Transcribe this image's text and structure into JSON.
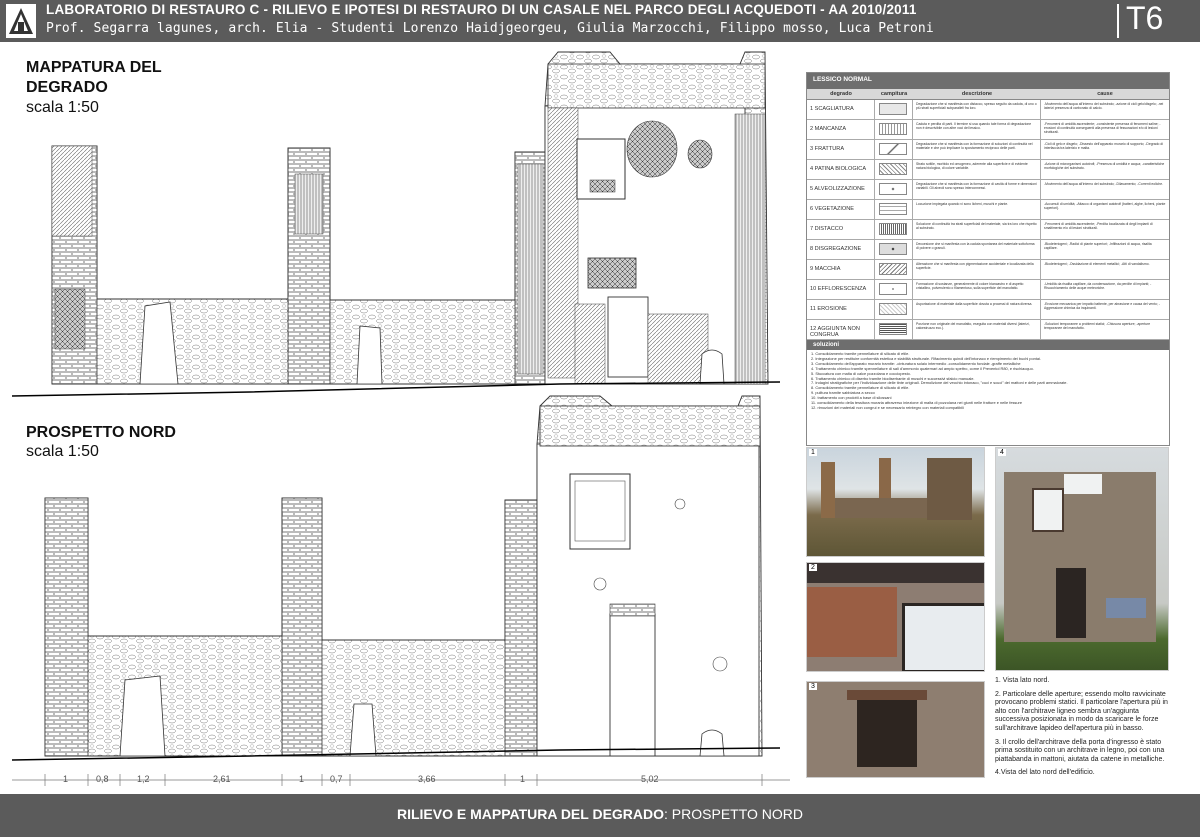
{
  "header": {
    "title": "LABORATORIO DI RESTAURO C - RILIEVO E IPOTESI DI RESTAURO DI UN CASALE NEL PARCO DEGLI ACQUEDOTI - AA 2010/2011",
    "subtitle": "Prof. Segarra lagunes, arch. Elia - Studenti Lorenzo Haidjgeorgeu, Giulia Marzocchi, Filippo mosso, Luca Petroni",
    "code": "T6"
  },
  "section1": {
    "title_line1": "MAPPATURA DEL",
    "title_line2": "DEGRADO",
    "scale": "scala 1:50"
  },
  "section2": {
    "title": "PROSPETTO NORD",
    "scale": "scala 1:50"
  },
  "legend": {
    "title": "LESSICO NORMAL",
    "columns": [
      "degrado",
      "campitura",
      "descrizione",
      "cause"
    ],
    "rows": [
      {
        "label": "1 SCAGLIATURA",
        "desc": "Degradazione che si manifesta con distacco, spesso seguito da caduta, di uno o più strati superficiali subparalleli fra loro.",
        "cause": "-Movimento dell'acqua all'interno del substrato; -azione di cicli gelo/disgelo; -nei laterizi presenza di carbonato di calcio."
      },
      {
        "label": "2 MANCANZA",
        "desc": "Caduta e perdita di parti. Il termine si usa quando tale forma di degradazione non è descrivibile con altre voci del lessico.",
        "cause": "-Fenomeni di umidità ascendente; -consistente presenza di fenomeni saline; -erosioni di continuità conseguenti alla presenza di fessurazioni e/o di lesioni strutturali."
      },
      {
        "label": "3 FRATTURA",
        "desc": "Degradazione che si manifesta con la formazione di soluzioni di continuità nel materiale e che può implicare lo spostamento reciproco delle parti.",
        "cause": "-Cicli di gelo e disgelo; -Dissesto dell'apparato murario di supporto; -Degrado di interfaccia tra laterizio e malta."
      },
      {
        "label": "4 PATINA BIOLOGICA",
        "desc": "Strato sottile, morbido ed omogeneo, aderente alla superficie e di evidente natura biologica, di colore variabile.",
        "cause": "-Azione di microrganismi autotrofi; -Presenza di umidità e acqua; -caratteristiche morfologiche del substrato."
      },
      {
        "label": "5 ALVEOLIZZAZIONE",
        "desc": "Degradazione che si manifesta con la formazione di cavità di forme e dimensioni variabili. Gli alveoli sono spesso interconnessi.",
        "cause": "-Movimento dell'acqua all'interno del substrato; -Dilavamento; -Correnti eoliche."
      },
      {
        "label": "6 VEGETAZIONE",
        "desc": "Locuzione impiegata quando vi sono licheni, muschi e piante.",
        "cause": "-Accumuli di umidità; -Attacco di organismi autotrofi (batteri, alghe, licheni, piante superiori)."
      },
      {
        "label": "7 DISTACCO",
        "desc": "Soluzione di continuità tra strati superficiali del materiale, sia tra loro che rispetto al substrato.",
        "cause": "-Fenomeni di umidità ascendente; -Perdita localizzata di degli impianti di smaltimento e/o di lesioni strutturali."
      },
      {
        "label": "8 DISGREGAZIONE",
        "desc": "Decoesione che si manifesta con la caduta spontanea del materiale sottoforma di polvere o granuli.",
        "cause": "-Biodeteriogeni; -Radici di piante superiori; -Infiltrazioni di acqua, risalita capillare."
      },
      {
        "label": "9 MACCHIA",
        "desc": "Alterazione che si manifesta con pigmentazione accidentale e localizzata della superficie.",
        "cause": "-Biodeteriogeni; -Ossidazione di elementi metallici; -Atti di vandalismo."
      },
      {
        "label": "10 EFFLORESCENZA",
        "desc": "Formazione di sostanze, generalmente di colore biancastro e di aspetto cristallino, pulverulento o filamentoso, sulla superficie del manufatto.",
        "cause": "-Umidità da risalita capillare, da condensazione, da perdite di impianti; -Risucchiamento delle acque meteoriche."
      },
      {
        "label": "11 EROSIONE",
        "desc": "Asportazione di materiale dalla superficie dovuta a processi di natura diversa.",
        "cause": "-Erosione meccanica per impatto battente, per abrasione e causa del vento; -Aggressione chimica da inquinanti."
      },
      {
        "label": "12 AGGIUNTA NON CONGRUA",
        "desc": "Porzione non originale del manufatto, eseguita con materiali diversi (laterizi, calcestruzzo ecc.).",
        "cause": "-Soluzioni temporanee a problemi statici; -Chiusura aperture; -aperture temporanee del manufatto."
      }
    ],
    "solutions_title": "soluzioni",
    "solutions": [
      "1. Consolidamento tramite pennellature di silicato di etile.",
      "2. Integrazione per restituire conformità estetica e stabilità strutturale. Rifacimento quindi dell'intonaco e riempimento dei buchi pontai.",
      "3. Consolidamento dell'apparato murario tramite: -cinturatura solaio intermedio -consolidamento fondale -graffe metalliche",
      "4. Trattamento chimico tramite spennellature di sali d'ammonio quaternari ad ampio spettro, come il Preventol R80, e rischiacquo.",
      "5. Stuccatura con malta di calce pozzolana e cocciopesto.",
      "6. Trattamento chimico di diserbo tramite biodiserbante di muschi e successivi sfalcio manuale.",
      "7. Indagini stratigrafiche per l'individuazione delle tinte originali. Demolizione del vecchio intonaco, \"cuci e scuci\" dei mattoni e delle parti ammalorate.",
      "8. Consolidamento tramite pennellature di silicato di etile.",
      "9. pulitura tramite sabbiatura a secco",
      "10. trattamento con prodotti a base di silossani",
      "11. consolidamento della tessitura muraria attraverso iniezione di malta di pozzolana nei giunti nelle fratture e nelle fessure",
      "12. rimozioni dei materiali non congrui e se necessario reintegro con materiali compatibili"
    ]
  },
  "photos": [
    {
      "num": "1"
    },
    {
      "num": "2"
    },
    {
      "num": "3"
    },
    {
      "num": "4"
    }
  ],
  "captions": [
    "1. Vista lato nord.",
    "2. Particolare delle aperture; essendo molto ravvicinate provocano problemi statici. Il particolare l'apertura più in alto con l'architrave ligneo sembra un'aggiunta successiva posizionata in modo da scaricare le forze sull'architrave lapideo dell'apertura più in basso.",
    "3. Il crollo dell'architrave della porta d'ingresso è stato prima sostituito con un architrave in legno, poi con una piattabanda in mattoni, aiutata da catene in metalliche.",
    "4.Vista del lato nord dell'edificio."
  ],
  "dimensions": [
    "1",
    "0,8",
    "1,2",
    "2,61",
    "1",
    "0,7",
    "3,66",
    "1",
    "5,02"
  ],
  "footer": {
    "bold": "RILIEVO E MAPPATURA DEL DEGRADO",
    "normal": ": PROSPETTO NORD"
  }
}
